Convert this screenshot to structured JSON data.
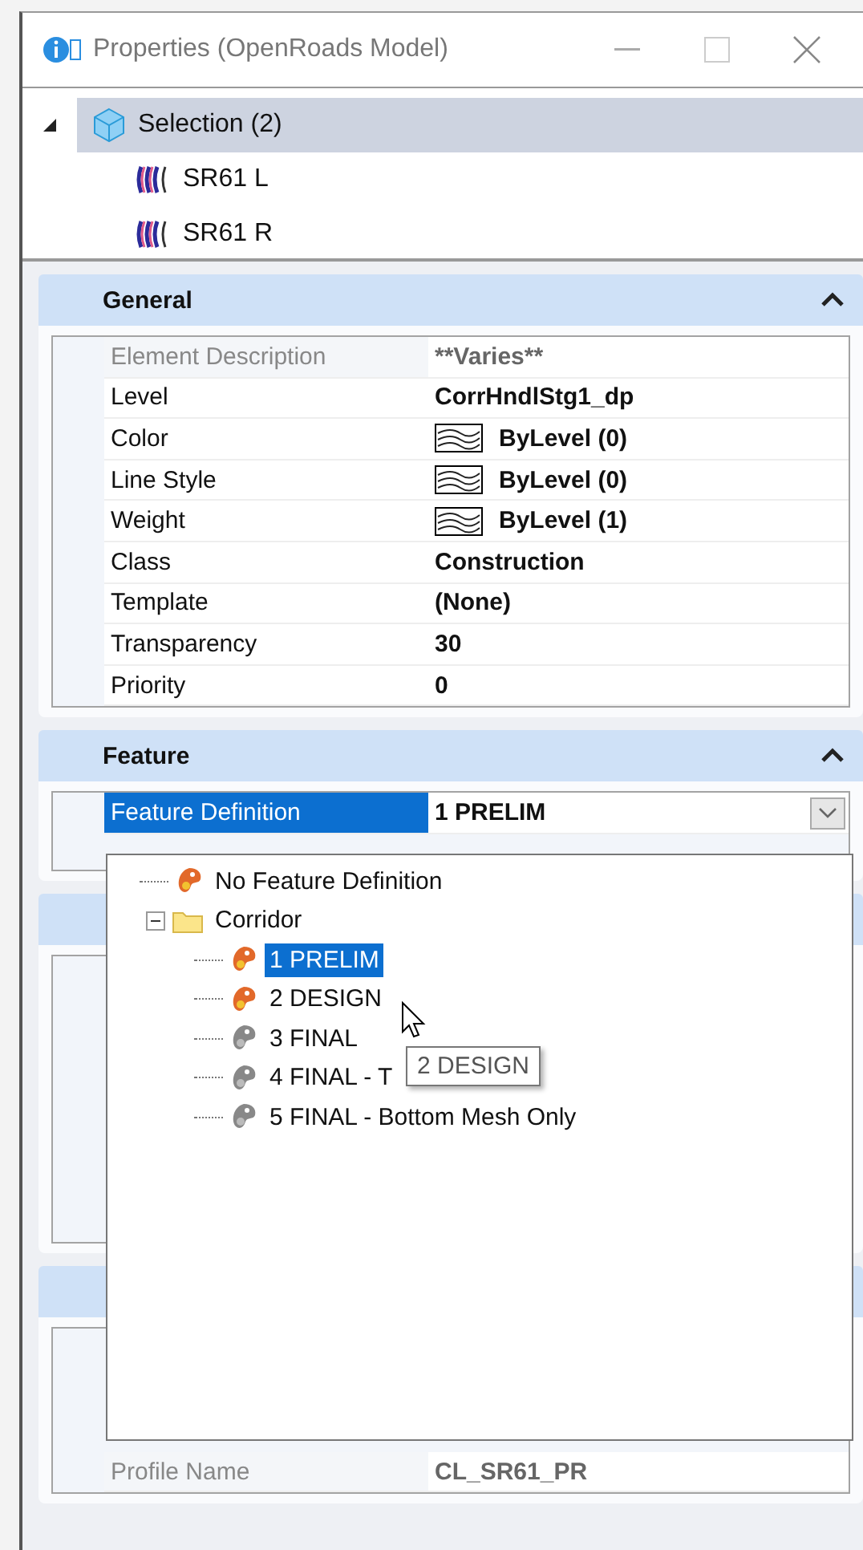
{
  "window": {
    "title": "Properties (OpenRoads Model)"
  },
  "selection_tree": {
    "label": "Selection (2)",
    "expanded": true,
    "selected": true,
    "children": [
      {
        "label": "SR61 L"
      },
      {
        "label": "SR61 R"
      }
    ]
  },
  "sections": [
    {
      "title": "General",
      "expanded": true,
      "rows": [
        {
          "kind": "text",
          "label": "Element Description",
          "value": "**Varies**",
          "disabled": true
        },
        {
          "kind": "text",
          "label": "Level",
          "value": "CorrHndlStg1_dp",
          "disabled": false
        },
        {
          "kind": "swatch",
          "label": "Color",
          "value": "ByLevel (0)",
          "disabled": false
        },
        {
          "kind": "swatch",
          "label": "Line Style",
          "value": "ByLevel (0)",
          "disabled": false
        },
        {
          "kind": "swatch",
          "label": "Weight",
          "value": "ByLevel (1)",
          "disabled": false
        },
        {
          "kind": "text",
          "label": "Class",
          "value": "Construction",
          "disabled": false
        },
        {
          "kind": "text",
          "label": "Template",
          "value": "(None)",
          "disabled": false
        },
        {
          "kind": "text",
          "label": "Transparency",
          "value": "30",
          "disabled": false
        },
        {
          "kind": "text",
          "label": "Priority",
          "value": "0",
          "disabled": false
        }
      ]
    },
    {
      "title": "Feature",
      "expanded": true,
      "rows": [
        {
          "kind": "dropdown",
          "label": "Feature Definition",
          "value": "1 PRELIM",
          "selected": true
        }
      ]
    },
    {
      "expanded": true
    },
    {
      "expanded": true,
      "rows": [
        {
          "kind": "text",
          "label": "Profile Name",
          "value": "CL_SR61_PR",
          "disabled": true
        }
      ]
    }
  ],
  "feature_dropdown": {
    "items": [
      {
        "kind": "feature",
        "label": "No Feature Definition",
        "available": true,
        "selected": false
      },
      {
        "kind": "folder",
        "label": "Corridor",
        "expanded": true,
        "children": [
          {
            "kind": "feature",
            "label": "1 PRELIM",
            "available": true,
            "selected": true
          },
          {
            "kind": "feature",
            "label": "2 DESIGN",
            "available": true,
            "selected": false
          },
          {
            "kind": "feature",
            "label": "3 FINAL",
            "available": false,
            "selected": false
          },
          {
            "kind": "feature",
            "label": "4 FINAL - T",
            "available": false,
            "selected": false
          },
          {
            "kind": "feature",
            "label": "5 FINAL - Bottom Mesh Only",
            "available": false,
            "selected": false
          }
        ]
      }
    ],
    "tooltip": "2 DESIGN"
  }
}
